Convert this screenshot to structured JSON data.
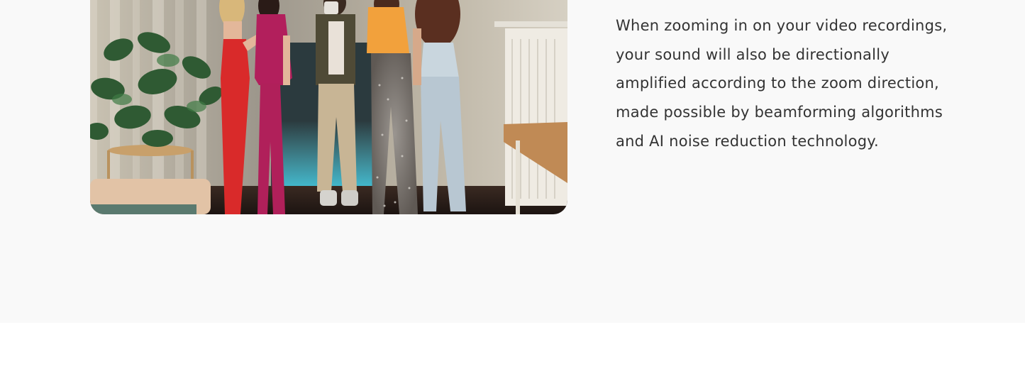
{
  "feature": {
    "description": "When zooming in on your video recordings, your sound will also be directionally amplified according to the zoom direction, made possible by beamforming algorithms and AI noise reduction technology."
  },
  "colors": {
    "section_background": "#f9f9f9",
    "page_background": "#ffffff",
    "text": "#333333"
  }
}
